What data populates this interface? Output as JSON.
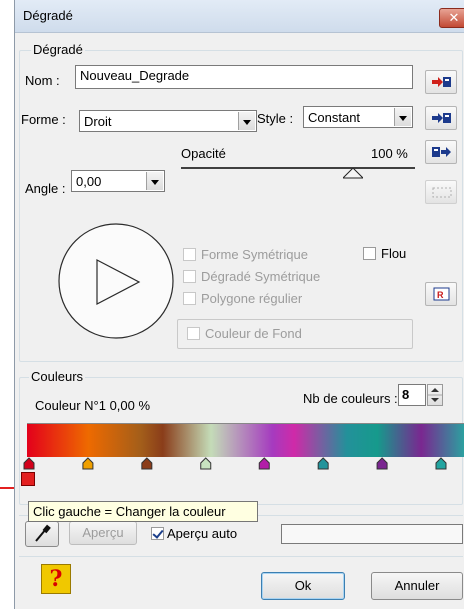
{
  "window": {
    "title": "Dégradé",
    "close_glyph": "✕"
  },
  "gradient_group": {
    "legend": "Dégradé"
  },
  "name": {
    "label": "Nom :",
    "value": "Nouveau_Degrade"
  },
  "form": {
    "label": "Forme :",
    "value": "Droit"
  },
  "style": {
    "label": "Style :",
    "value": "Constant"
  },
  "opacity": {
    "label": "Opacité",
    "value": "100 %",
    "level": 1.0
  },
  "angle": {
    "label": "Angle :",
    "value": "0,00"
  },
  "options": {
    "forme_symetrique": {
      "label": "Forme Symétrique",
      "checked": false,
      "enabled": false
    },
    "flou": {
      "label": "Flou",
      "checked": false,
      "enabled": true
    },
    "degrade_symetrique": {
      "label": "Dégradé Symétrique",
      "checked": false,
      "enabled": false
    },
    "polygone_regulier": {
      "label": "Polygone régulier",
      "checked": false,
      "enabled": false
    },
    "couleur_de_fond": {
      "label": "Couleur de Fond",
      "checked": false,
      "enabled": false
    }
  },
  "colors_group": {
    "legend": "Couleurs",
    "current": "Couleur N°1 0,00 %",
    "count_label": "Nb de couleurs :",
    "count_value": "8"
  },
  "gradient_stops": [
    {
      "color": "#d3001a",
      "pos": 0.0
    },
    {
      "color": "#f0a000",
      "pos": 0.143
    },
    {
      "color": "#8b3d1a",
      "pos": 0.286
    },
    {
      "color": "#c8e4c0",
      "pos": 0.429
    },
    {
      "color": "#b21ea8",
      "pos": 0.571
    },
    {
      "color": "#22949b",
      "pos": 0.714
    },
    {
      "color": "#7a2690",
      "pos": 0.857
    },
    {
      "color": "#22a4a0",
      "pos": 1.0
    }
  ],
  "tooltip": "Clic gauche = Changer la couleur",
  "preview": {
    "button": "Aperçu",
    "auto_label": "Aperçu auto",
    "auto_checked": true
  },
  "buttons": {
    "ok": "Ok",
    "cancel": "Annuler",
    "help_glyph": "?"
  },
  "colors": {
    "accent_red": "#e32020",
    "title_bg": "#dbe6f4",
    "tooltip_bg": "#ffffe1"
  }
}
